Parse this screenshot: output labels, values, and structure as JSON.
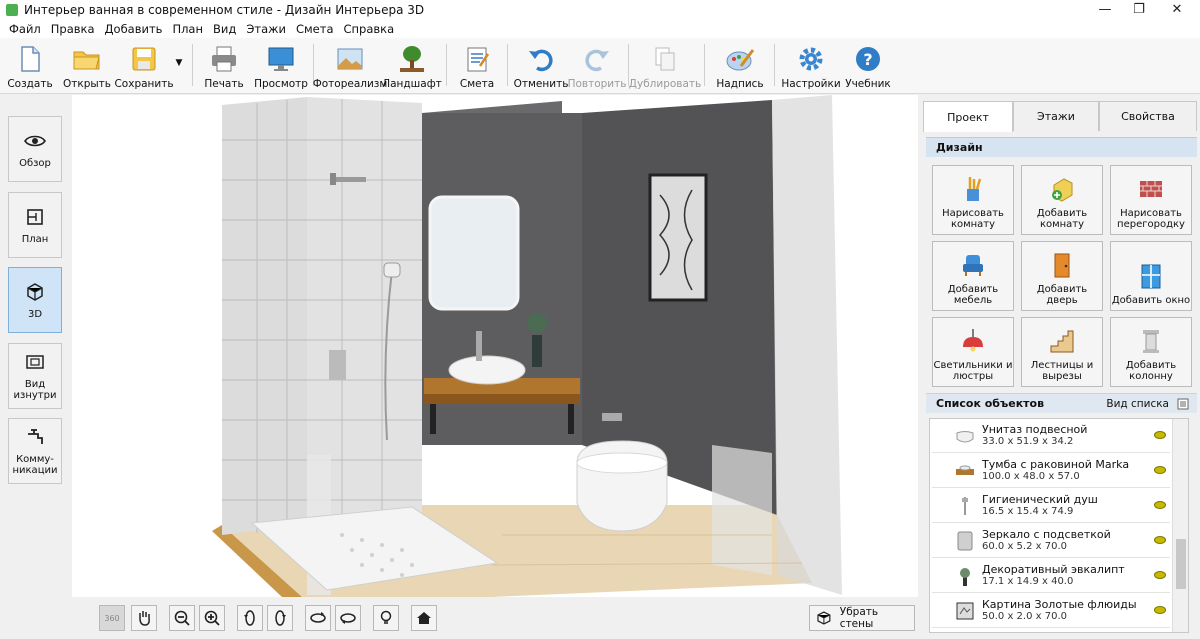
{
  "window": {
    "title": "Интерьер ванная в современном стиле - Дизайн Интерьера 3D",
    "minimize": "—",
    "maximize": "❐",
    "close": "✕"
  },
  "menu": [
    "Файл",
    "Правка",
    "Добавить",
    "План",
    "Вид",
    "Этажи",
    "Смета",
    "Справка"
  ],
  "toolbar": {
    "create": "Создать",
    "open": "Открыть",
    "save": "Сохранить",
    "print": "Печать",
    "preview": "Просмотр",
    "photo": "Фотореализм",
    "landscape": "Ландшафт",
    "estimate": "Смета",
    "undo": "Отменить",
    "redo": "Повторить",
    "duplicate": "Дублировать",
    "label": "Надпись",
    "settings": "Настройки",
    "tutorial": "Учебник"
  },
  "left_tabs": {
    "overview": "Обзор",
    "plan": "План",
    "view3d": "3D",
    "inside": "Вид изнутри",
    "comm": "Комму-никации"
  },
  "bottom": {
    "rotate360": "360",
    "remove_walls": "Убрать стены"
  },
  "right": {
    "tabs": [
      "Проект",
      "Этажи",
      "Свойства"
    ],
    "design_header": "Дизайн",
    "design_buttons": [
      "Нарисовать комнату",
      "Добавить комнату",
      "Нарисовать перегородку",
      "Добавить мебель",
      "Добавить дверь",
      "Добавить окно",
      "Светильники и люстры",
      "Лестницы и вырезы",
      "Добавить колонну"
    ],
    "objects_header": "Список объектов",
    "view_list": "Вид списка",
    "objects": [
      {
        "name": "Унитаз подвесной",
        "dims": "33.0 x 51.9 x 34.2"
      },
      {
        "name": "Тумба с раковиной Marka",
        "dims": "100.0 x 48.0 x 57.0"
      },
      {
        "name": "Гигиенический душ",
        "dims": "16.5 x 15.4 x 74.9"
      },
      {
        "name": "Зеркало с подсветкой",
        "dims": "60.0 x 5.2 x 70.0"
      },
      {
        "name": "Декоративный эвкалипт",
        "dims": "17.1 x 14.9 x 40.0"
      },
      {
        "name": "Картина Золотые флюиды",
        "dims": "50.0 x 2.0 x 70.0"
      }
    ]
  },
  "colors": {
    "accent": "#cfe4f7",
    "header": "#d6e4f2",
    "wall_dark": "#5d5d5f",
    "tile": "#d9d9d9",
    "floor": "#e8d6b4",
    "wood": "#b0762e"
  }
}
